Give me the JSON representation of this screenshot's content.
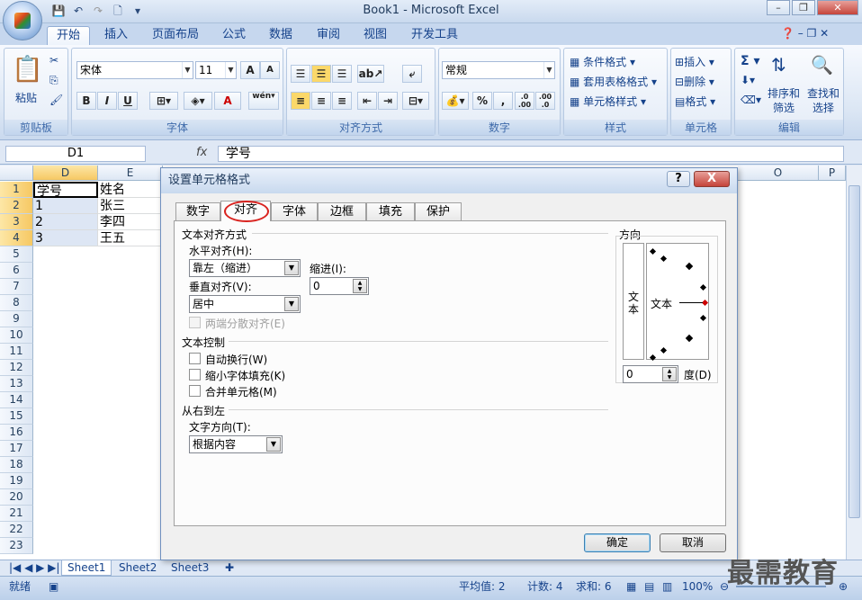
{
  "window": {
    "title": "Book1 - Microsoft Excel"
  },
  "ribbon": {
    "tabs": [
      "开始",
      "插入",
      "页面布局",
      "公式",
      "数据",
      "审阅",
      "视图",
      "开发工具"
    ],
    "clipboard": {
      "paste": "粘贴",
      "label": "剪贴板"
    },
    "font": {
      "name": "宋体",
      "size": "11",
      "label": "字体",
      "bold": "B",
      "italic": "I",
      "underline": "U",
      "grow": "A",
      "shrink": "A",
      "color": "A",
      "pinyin": "wén\n变"
    },
    "alignment": {
      "label": "对齐方式"
    },
    "number": {
      "format": "常规",
      "label": "数字",
      "percent": "%",
      "comma": ",",
      "inc": ".0 .00",
      "dec": ".00 .0"
    },
    "styles": {
      "conditional": "条件格式",
      "table": "套用表格格式",
      "cell": "单元格样式",
      "label": "样式"
    },
    "cells": {
      "insert": "插入",
      "delete": "删除",
      "format": "格式",
      "label": "单元格"
    },
    "editing": {
      "sum": "Σ",
      "sort": "排序和\n筛选",
      "find": "查找和\n选择",
      "label": "编辑"
    }
  },
  "formula_bar": {
    "namebox": "D1",
    "fx": "fx",
    "value": "学号"
  },
  "grid": {
    "columns": [
      "D",
      "E",
      "O",
      "P"
    ],
    "rows": [
      "1",
      "2",
      "3",
      "4",
      "5",
      "6",
      "7",
      "8",
      "9",
      "10",
      "11",
      "12",
      "13",
      "14",
      "15",
      "16",
      "17",
      "18",
      "19",
      "20",
      "21",
      "22",
      "23"
    ],
    "cells": {
      "d1": "学号",
      "d2": "1",
      "d3": "2",
      "d4": "3",
      "e1": "姓名",
      "e2": "张三",
      "e3": "李四",
      "e4": "王五"
    }
  },
  "sheets": [
    "Sheet1",
    "Sheet2",
    "Sheet3"
  ],
  "status": {
    "mode": "就绪",
    "average": "平均值: 2",
    "count": "计数: 4",
    "sum": "求和: 6",
    "zoom": "100%"
  },
  "dialog": {
    "title": "设置单元格格式",
    "help": "?",
    "close": "X",
    "tabs": [
      "数字",
      "对齐",
      "字体",
      "边框",
      "填充",
      "保护"
    ],
    "text_alignment": "文本对齐方式",
    "horizontal_label": "水平对齐(H):",
    "horizontal_value": "靠左（缩进）",
    "indent_label": "缩进(I):",
    "indent_value": "0",
    "vertical_label": "垂直对齐(V):",
    "vertical_value": "居中",
    "justify_distributed": "两端分散对齐(E)",
    "text_control": "文本控制",
    "wrap": "自动换行(W)",
    "shrink": "缩小字体填充(K)",
    "merge": "合并单元格(M)",
    "rtl": "从右到左",
    "direction_label": "文字方向(T):",
    "direction_value": "根据内容",
    "orientation": "方向",
    "orient_vertical": "文本",
    "orient_horizontal": "文本",
    "degrees_value": "0",
    "degrees_label": "度(D)",
    "ok": "确定",
    "cancel": "取消"
  },
  "watermark": "最需教育"
}
